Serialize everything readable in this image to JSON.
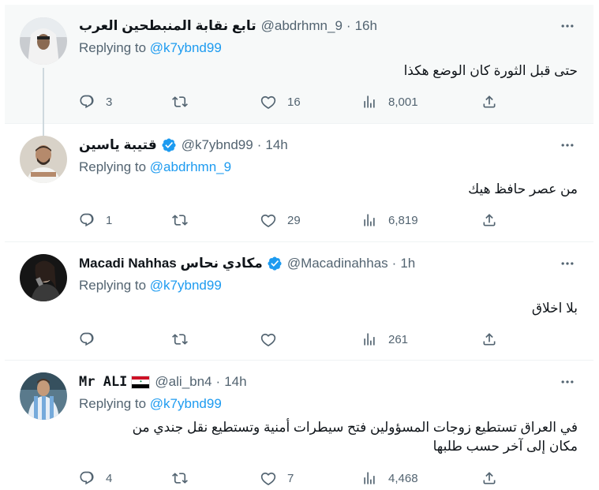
{
  "tweets": [
    {
      "name": "تابع نقابة المنبطحين العرب",
      "handle": "@abdrhmn_9",
      "time": "16h",
      "replying_prefix": "Replying to",
      "replying_to": "@k7ybnd99",
      "text": "حتى قبل الثورة كان الوضع هكذا",
      "replies": "3",
      "retweets": "",
      "likes": "16",
      "views": "8,001"
    },
    {
      "name": "قتيبة ياسين",
      "handle": "@k7ybnd99",
      "time": "14h",
      "verified": true,
      "replying_prefix": "Replying to",
      "replying_to": "@abdrhmn_9",
      "text": "من عصر حافظ هيك",
      "replies": "1",
      "retweets": "",
      "likes": "29",
      "views": "6,819"
    },
    {
      "name": "Macadi Nahhas مكادي نحاس",
      "handle": "@Macadinahhas",
      "time": "1h",
      "verified": true,
      "replying_prefix": "Replying to",
      "replying_to": "@k7ybnd99",
      "text": "بلا اخلاق",
      "replies": "",
      "retweets": "",
      "likes": "",
      "views": "261"
    },
    {
      "name": "Mr ALI",
      "handle": "@ali_bn4",
      "time": "14h",
      "flag": "iraq-flag-icon",
      "replying_prefix": "Replying to",
      "replying_to": "@k7ybnd99",
      "text_line1": "في العراق تستطيع زوجات المسؤولين فتح سيطرات أمنية وتستطيع نقل جندي من",
      "text_line2": "مكان إلى آخر حسب طلبها",
      "replies": "4",
      "retweets": "",
      "likes": "7",
      "views": "4,468"
    }
  ],
  "colors": {
    "accent": "#1d9bf0",
    "secondary_text": "#536471",
    "highlight_bg": "#f7f9f9"
  }
}
